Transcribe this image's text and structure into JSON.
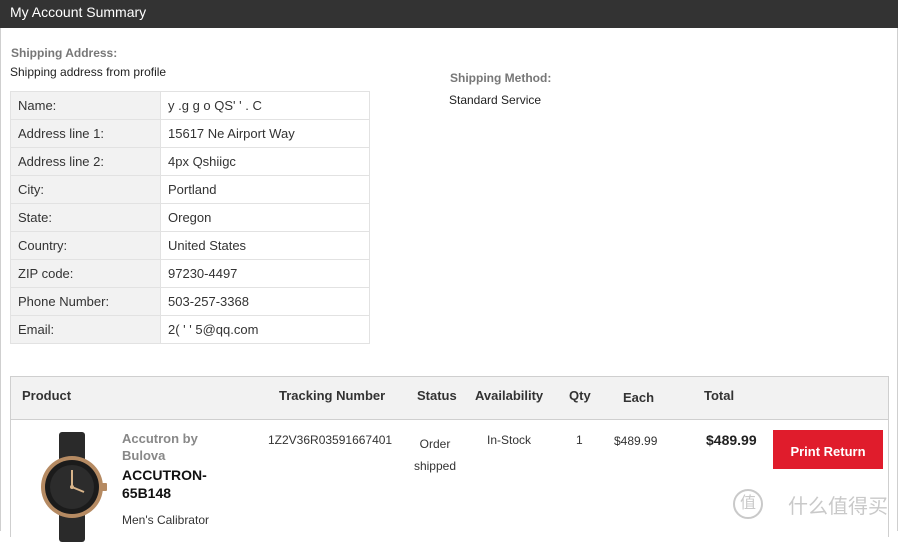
{
  "header": {
    "title": "My Account Summary"
  },
  "shipping_address": {
    "label": "Shipping Address:",
    "note": "Shipping address from profile",
    "rows": [
      {
        "key": "Name:",
        "value": "y  .g    g  o QS'  '  . C"
      },
      {
        "key": "Address line 1:",
        "value": "15617 Ne Airport Way"
      },
      {
        "key": "Address line 2:",
        "value": "4px Qshiigc"
      },
      {
        "key": "City:",
        "value": "Portland"
      },
      {
        "key": "State:",
        "value": "Oregon"
      },
      {
        "key": "Country:",
        "value": "United States"
      },
      {
        "key": "ZIP code:",
        "value": "97230-4497"
      },
      {
        "key": "Phone Number:",
        "value": "503-257-3368"
      },
      {
        "key": "Email:",
        "value": "2(    '  '  5@qq.com"
      }
    ]
  },
  "shipping_method": {
    "label": "Shipping Method:",
    "value": "Standard Service"
  },
  "orders": {
    "headers": {
      "product": "Product",
      "tracking": "Tracking Number",
      "status": "Status",
      "availability": "Availability",
      "qty": "Qty",
      "each": "Each",
      "total": "Total"
    },
    "item": {
      "brand": "Accutron by Bulova",
      "model": "ACCUTRON- 65B148",
      "description": "Men's Calibrator",
      "tracking": "1Z2V36R03591667401",
      "status": "Order shipped",
      "availability": "In-Stock",
      "qty": "1",
      "each": "$489.99",
      "total": "$489.99",
      "action": "Print Return"
    }
  },
  "watermark": {
    "text": "什么值得买",
    "icon": "值"
  },
  "colors": {
    "titlebar": "#333333",
    "button": "#e01c2c",
    "label_gray": "#777777"
  }
}
